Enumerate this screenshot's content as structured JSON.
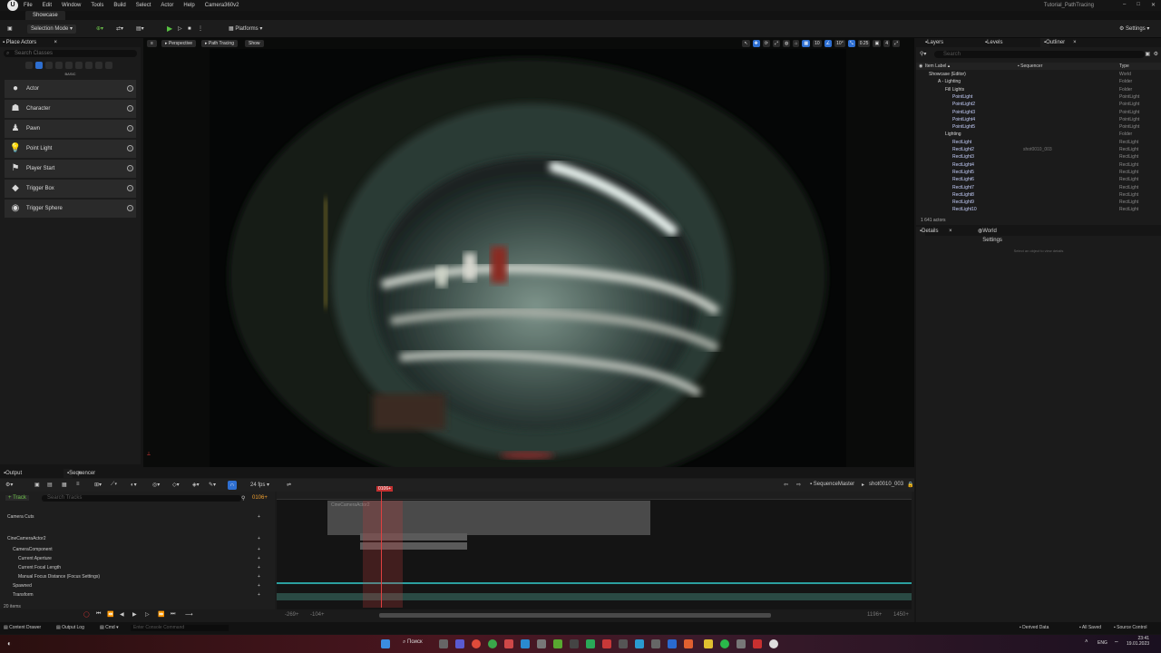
{
  "menubar": {
    "logo": "U",
    "items": [
      "File",
      "Edit",
      "Window",
      "Tools",
      "Build",
      "Select",
      "Actor",
      "Help",
      "Camera360v2"
    ],
    "project": "Tutorial_PathTracing",
    "window_controls": [
      "–",
      "□",
      "✕"
    ]
  },
  "level_tab": "Showcase",
  "toolbar": {
    "selection_mode": "Selection Mode",
    "platforms": "Platforms",
    "settings": "Settings"
  },
  "place_actors": {
    "title": "Place Actors",
    "search_placeholder": "Search Classes",
    "section": "BASIC",
    "items": [
      {
        "label": "Actor",
        "icon": "actor-icon"
      },
      {
        "label": "Character",
        "icon": "character-icon"
      },
      {
        "label": "Pawn",
        "icon": "pawn-icon"
      },
      {
        "label": "Point Light",
        "icon": "point-light-icon"
      },
      {
        "label": "Player Start",
        "icon": "player-start-icon"
      },
      {
        "label": "Trigger Box",
        "icon": "trigger-box-icon"
      },
      {
        "label": "Trigger Sphere",
        "icon": "trigger-sphere-icon"
      }
    ]
  },
  "viewport": {
    "perspective": "Perspective",
    "view_mode": "Path Tracing",
    "show": "Show",
    "snap_values": [
      "10",
      "10°",
      "0.25",
      "4"
    ]
  },
  "outliner": {
    "tabs": [
      "Layers",
      "Levels",
      "Outliner"
    ],
    "search_placeholder": "Search",
    "col_label": "Item Label ▴",
    "col_sequencer": "Sequencer",
    "col_type": "Type",
    "rows": [
      {
        "name": "Showcase (Editor)",
        "type": "World",
        "seq": ""
      },
      {
        "name": "A - Lighting",
        "type": "Folder",
        "seq": ""
      },
      {
        "name": "Fill Lights",
        "type": "Folder",
        "seq": ""
      },
      {
        "name": "PointLight",
        "type": "PointLight",
        "seq": ""
      },
      {
        "name": "PointLight2",
        "type": "PointLight",
        "seq": ""
      },
      {
        "name": "PointLight3",
        "type": "PointLight",
        "seq": ""
      },
      {
        "name": "PointLight4",
        "type": "PointLight",
        "seq": ""
      },
      {
        "name": "PointLight5",
        "type": "PointLight",
        "seq": ""
      },
      {
        "name": "Lighting",
        "type": "Folder",
        "seq": ""
      },
      {
        "name": "RectLight",
        "type": "RectLight",
        "seq": ""
      },
      {
        "name": "RectLight2",
        "type": "RectLight",
        "seq": "shot0010_003"
      },
      {
        "name": "RectLight3",
        "type": "RectLight",
        "seq": ""
      },
      {
        "name": "RectLight4",
        "type": "RectLight",
        "seq": ""
      },
      {
        "name": "RectLight5",
        "type": "RectLight",
        "seq": ""
      },
      {
        "name": "RectLight6",
        "type": "RectLight",
        "seq": ""
      },
      {
        "name": "RectLight7",
        "type": "RectLight",
        "seq": ""
      },
      {
        "name": "RectLight8",
        "type": "RectLight",
        "seq": ""
      },
      {
        "name": "RectLight9",
        "type": "RectLight",
        "seq": ""
      },
      {
        "name": "RectLight10",
        "type": "RectLight",
        "seq": ""
      }
    ],
    "actor_count": "1 641 actors"
  },
  "details": {
    "tabs": [
      "Details",
      "World Settings"
    ],
    "empty_message": "Select an object to view details"
  },
  "sequencer": {
    "tabs": [
      "Output Log",
      "Sequencer"
    ],
    "add_track": "+ Track",
    "search_placeholder": "Search Tracks",
    "fps": "24 fps",
    "current_frame": "0106+",
    "breadcrumb_root": "SequenceMaster",
    "breadcrumb_shot": "shot0010_003",
    "playhead_label": "0106+",
    "section_label": "CineCameraActor2",
    "tracks": [
      {
        "label": "Camera Cuts",
        "indent": 0
      },
      {
        "label": "CineCameraActor2",
        "indent": 0
      },
      {
        "label": "CameraComponent",
        "indent": 1
      },
      {
        "label": "Current Aperture",
        "indent": 2
      },
      {
        "label": "Current Focal Length",
        "indent": 2
      },
      {
        "label": "Manual Focus Distance (Focus Settings)",
        "indent": 2
      },
      {
        "label": "Spawned",
        "indent": 1
      },
      {
        "label": "Transform",
        "indent": 1
      }
    ],
    "item_count": "20 items",
    "range_start": "-269+",
    "range_start2": "-104+",
    "range_end": "1196+",
    "range_end2": "1450+"
  },
  "statusbar": {
    "content_drawer": "Content Drawer",
    "output_log": "Output Log",
    "cmd": "Cmd",
    "console_placeholder": "Enter Console Command",
    "derived_data": "Derived Data",
    "all_saved": "All Saved",
    "source_control": "Source Control"
  },
  "taskbar": {
    "search": "Поиск",
    "lang": "ENG",
    "time": "23:41",
    "date": "19.01.2023"
  }
}
